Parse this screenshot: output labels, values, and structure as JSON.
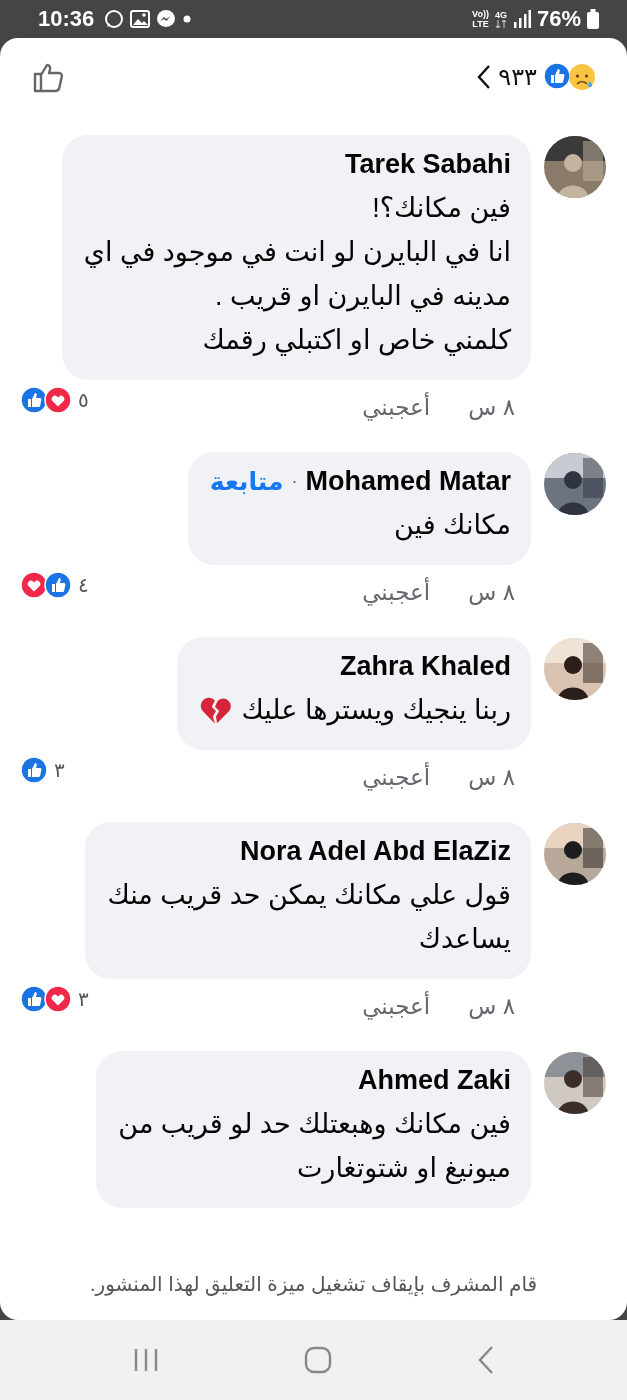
{
  "status_bar": {
    "time": "10:36",
    "volte_top": "Vo))",
    "volte_bottom": "LTE",
    "network": "4G",
    "battery": "76%"
  },
  "header": {
    "reaction_count": "٩٣٣",
    "reactions": [
      {
        "kind": "like"
      },
      {
        "kind": "sad"
      }
    ]
  },
  "comments": [
    {
      "author": "Tarek Sabahi",
      "lines": [
        "فين مكانك؟!",
        "انا في البايرن لو انت في موجود في اي",
        "مدينه في البايرن او قريب .",
        "كلمني خاص او اكتبلي رقمك"
      ],
      "time": "٨ س",
      "like_action": "أعجبني",
      "reactions": [
        {
          "kind": "like"
        },
        {
          "kind": "love"
        }
      ],
      "reaction_count": "٥"
    },
    {
      "author": "Mohamed Matar",
      "separator": "·",
      "follow": "متابعة",
      "lines": [
        "مكانك فين"
      ],
      "time": "٨ س",
      "like_action": "أعجبني",
      "reactions": [
        {
          "kind": "love"
        },
        {
          "kind": "like"
        }
      ],
      "reaction_count": "٤"
    },
    {
      "author": "Zahra Khaled",
      "lines": [
        "ربنا ينجيك ويسترها عليك"
      ],
      "attachment": {
        "kind": "broken-heart"
      },
      "time": "٨ س",
      "like_action": "أعجبني",
      "reactions": [
        {
          "kind": "like"
        }
      ],
      "reaction_count": "٣"
    },
    {
      "author": "Nora Adel Abd ElaZiz",
      "lines": [
        "قول علي مكانك يمكن حد قريب منك",
        "يساعدك"
      ],
      "time": "٨ س",
      "like_action": "أعجبني",
      "reactions": [
        {
          "kind": "like"
        },
        {
          "kind": "love"
        }
      ],
      "reaction_count": "٣"
    },
    {
      "author": "Ahmed Zaki",
      "lines": [
        "فين مكانك وهبعتلك حد لو قريب من",
        "ميونيغ او شتوتغارت"
      ]
    }
  ],
  "notice": "قام المشرف بإيقاف تشغيل ميزة التعليق لهذا المنشور."
}
